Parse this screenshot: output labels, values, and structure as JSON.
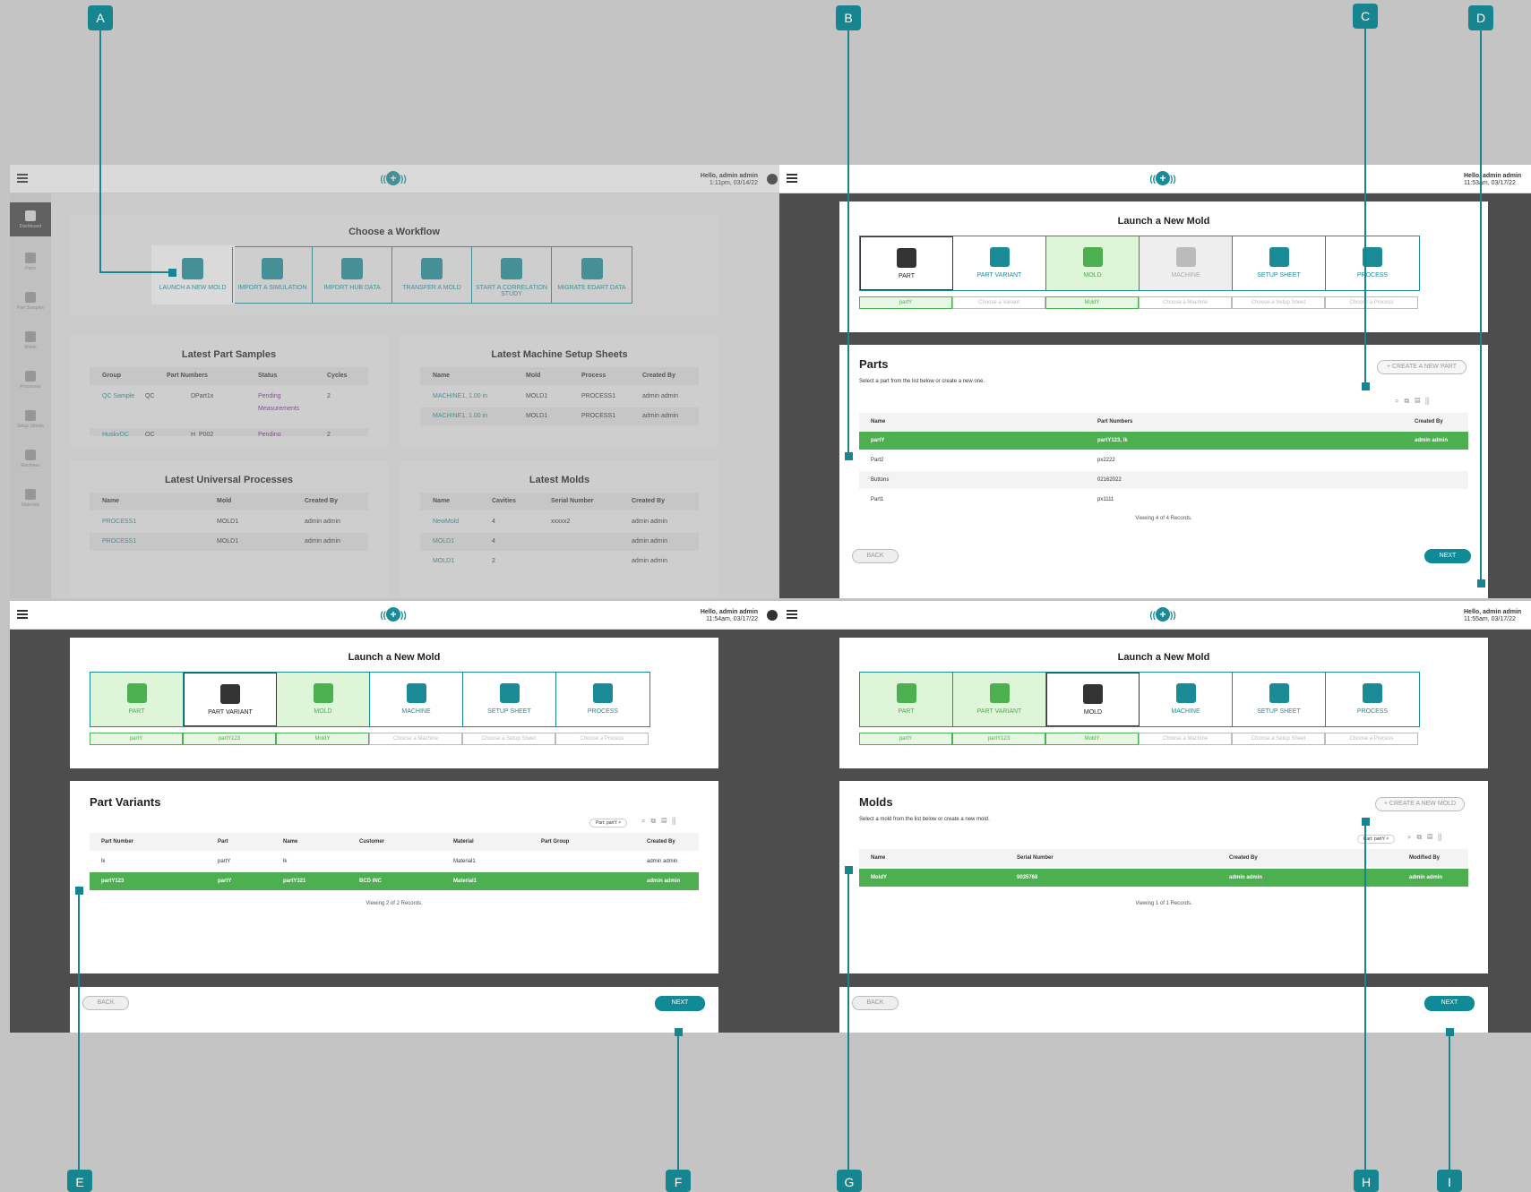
{
  "markers": [
    "A",
    "B",
    "C",
    "D",
    "E",
    "F",
    "G",
    "H",
    "I"
  ],
  "common": {
    "menu_icon": "hamburger-menu-icon",
    "logo_icon": "wireless-plus-logo",
    "hello": "Hello, admin admin"
  },
  "dashboard": {
    "time": "1:11pm, 03/14/22",
    "sidebar": [
      "Dashboard",
      "Parts",
      "Part Samples",
      "Molds",
      "Processes",
      "Setup Sheets",
      "Machines",
      "Materials"
    ],
    "workflow_title": "Choose a Workflow",
    "workflows": [
      "LAUNCH A NEW MOLD",
      "IMPORT A SIMULATION",
      "IMPORT HUB DATA",
      "TRANSFER A MOLD",
      "START A CORRELATION STUDY",
      "MIGRATE EDART DATA"
    ],
    "part_samples": {
      "title": "Latest Part Samples",
      "headers": [
        "Group",
        "Part Numbers",
        "Status",
        "Cycles"
      ],
      "rows": [
        [
          "QC Sample",
          "QC",
          "DPart1x",
          "Pending Measurements",
          "2"
        ],
        [
          "HuskyQC",
          "QC",
          "H_P002",
          "Pending",
          "2"
        ]
      ]
    },
    "setup_sheets": {
      "title": "Latest Machine Setup Sheets",
      "headers": [
        "Name",
        "Mold",
        "Process",
        "Created By"
      ],
      "rows": [
        [
          "MACHINE1, 1.00 in",
          "MOLD1",
          "PROCESS1",
          "admin admin"
        ],
        [
          "MACHINE1, 1.00 in",
          "MOLD1",
          "PROCESS1",
          "admin admin"
        ]
      ]
    },
    "processes": {
      "title": "Latest Universal Processes",
      "headers": [
        "Name",
        "Mold",
        "Created By"
      ],
      "rows": [
        [
          "PROCESS1",
          "MOLD1",
          "admin admin"
        ],
        [
          "PROCESS1",
          "MOLD1",
          "admin admin"
        ]
      ]
    },
    "molds": {
      "title": "Latest Molds",
      "headers": [
        "Name",
        "Cavities",
        "Serial Number",
        "Created By"
      ],
      "rows": [
        [
          "NewMold",
          "4",
          "xxxxx2",
          "admin admin"
        ],
        [
          "MOLD1",
          "4",
          "",
          "admin admin"
        ],
        [
          "MOLD1",
          "2",
          "",
          "admin admin"
        ]
      ]
    }
  },
  "launch": {
    "title": "Launch a New Mold",
    "steps": [
      "PART",
      "PART VARIANT",
      "MOLD",
      "MACHINE",
      "SETUP SHEET",
      "PROCESS"
    ],
    "back": "BACK",
    "next": "NEXT"
  },
  "parts_panel": {
    "time": "11:53am, 03/17/22",
    "chips": [
      "partY",
      "Choose a Variant",
      "MoldY",
      "Choose a Machine",
      "Choose a Setup Sheet",
      "Choose a Process"
    ],
    "title": "Parts",
    "subtitle": "Select a part from the list below or create a new one.",
    "create": "+ CREATE A NEW PART",
    "headers": [
      "Name",
      "Part Numbers",
      "Created By"
    ],
    "rows": [
      [
        "partY",
        "partY123, lk",
        "admin admin"
      ],
      [
        "Part2",
        "px2222",
        ""
      ],
      [
        "Buttons",
        "02162022",
        ""
      ],
      [
        "Part1",
        "px1111",
        ""
      ]
    ],
    "viewing": "Viewing 4 of 4 Records."
  },
  "variants_panel": {
    "time": "11:54am, 03/17/22",
    "chips": [
      "partY",
      "partY123",
      "MoldY",
      "Choose a Machine",
      "Choose a Setup Sheet",
      "Choose a Process"
    ],
    "title": "Part Variants",
    "filter": "Part: partY",
    "headers": [
      "Part Number",
      "Part",
      "Name",
      "Customer",
      "Material",
      "Part Group",
      "Created By"
    ],
    "rows": [
      [
        "lk",
        "partY",
        "lk",
        "",
        "Material1",
        "",
        "admin admin"
      ],
      [
        "partY123",
        "partY",
        "partY321",
        "BCD INC",
        "Material1",
        "",
        "admin admin"
      ]
    ],
    "viewing": "Viewing 2 of 2 Records."
  },
  "molds_panel": {
    "time": "11:55am, 03/17/22",
    "chips": [
      "partY",
      "partY123",
      "MoldY",
      "Choose a Machine",
      "Choose a Setup Sheet",
      "Choose a Process"
    ],
    "title": "Molds",
    "subtitle": "Select a mold from the list below or create a new mold.",
    "create": "+ CREATE A NEW MOLD",
    "filter": "Part: partY",
    "headers": [
      "Name",
      "Serial Number",
      "Created By",
      "Modified By"
    ],
    "rows": [
      [
        "MoldY",
        "9035768",
        "admin admin",
        "admin admin"
      ]
    ],
    "viewing": "Viewing 1 of 1 Records."
  }
}
